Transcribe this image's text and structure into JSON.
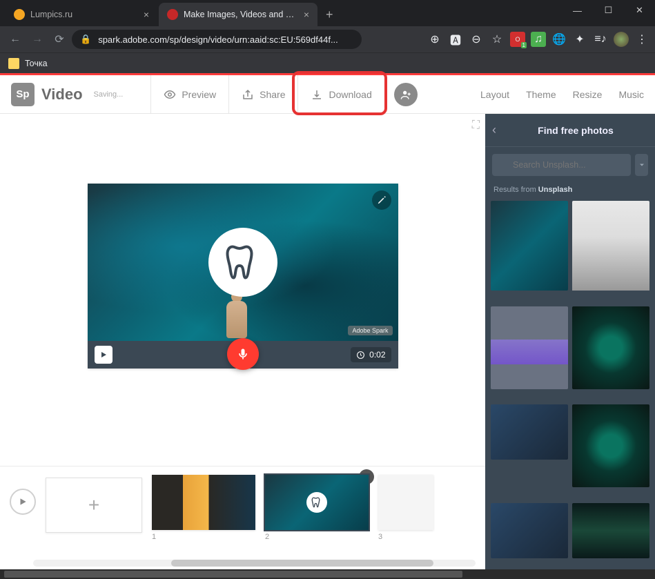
{
  "browser": {
    "tabs": [
      {
        "title": "Lumpics.ru",
        "favicon_color": "#f5a623",
        "active": false
      },
      {
        "title": "Make Images, Videos and Web S",
        "favicon_color": "#c62828",
        "active": true
      }
    ],
    "url": "spark.adobe.com/sp/design/video/urn:aaid:sc:EU:569df44f...",
    "bookmark_label": "Точка"
  },
  "app": {
    "brand_logo": "Sp",
    "brand_title": "Video",
    "brand_status": "Saving...",
    "actions": {
      "preview": "Preview",
      "share": "Share",
      "download": "Download"
    },
    "tabs": {
      "layout": "Layout",
      "theme": "Theme",
      "resize": "Resize",
      "music": "Music"
    },
    "stage": {
      "watermark": "Adobe Spark",
      "timer": "0:02"
    },
    "timeline": {
      "slides": [
        "1",
        "2",
        "3"
      ]
    }
  },
  "sidebar": {
    "title": "Find free photos",
    "search_placeholder": "Search Unsplash...",
    "results_prefix": "Results from ",
    "results_source": "Unsplash"
  }
}
